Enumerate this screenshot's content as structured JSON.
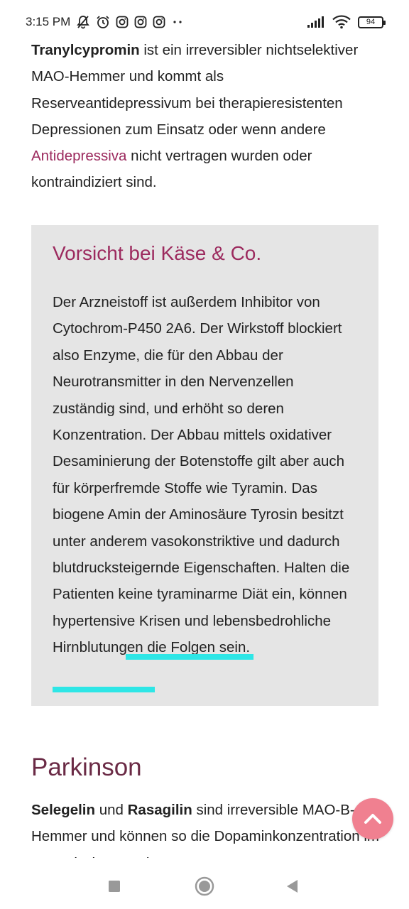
{
  "status_bar": {
    "time": "3:15 PM",
    "battery": "94",
    "icons": [
      "silent-bell-icon",
      "alarm-icon",
      "instagram-icon",
      "instagram-icon",
      "instagram-icon",
      "more-dots-icon",
      "signal-icon",
      "wifi-icon",
      "battery-icon"
    ]
  },
  "article": {
    "intro": {
      "term": "Tranylcypromin",
      "text_1": " ist ein irreversibler nichtselektiver MAO-Hemmer und kommt als Reserveantidepressivum bei therapieresistenten Depressionen zum Einsatz oder wenn andere ",
      "link": "Antidepressiva",
      "text_2": " nicht vertragen wurden oder kontraindiziert sind."
    },
    "callout": {
      "title": "Vorsicht bei Käse & Co.",
      "body": "Der Arzneistoff ist außerdem Inhibitor von Cytochrom-P450 2A6. Der Wirkstoff blockiert also Enzyme, die für den Abbau der Neurotransmitter in den Nervenzellen zuständig sind, und erhöht so deren Konzentration. Der Abbau mittels oxidativer Desaminierung der Botenstoffe gilt aber auch für körperfremde Stoffe wie Tyramin. Das biogene Amin der Aminosäure Tyrosin besitzt unter anderem vasokonstriktive und dadurch blutdrucksteigernde Eigenschaften. Halten die Patienten keine tyraminarme Diät ein, können hypertensive Krisen und ",
      "highlight": "lebensbedrohliche Hirnblutungen",
      "body_end": " die Folgen sein."
    },
    "section": {
      "title": "Parkinson",
      "term_1": "Selegelin",
      "and": " und ",
      "term_2": "Rasagilin",
      "text": " sind irreversible MAO-B-Hemmer und können so die Dopaminkonzentration im synaptischen Spalt"
    }
  },
  "colors": {
    "accent": "#9c2a5e",
    "section_title": "#6a2a45",
    "callout_bg": "#e5e5e5",
    "highlight": "#2ee6e6",
    "scroll_button": "#f08090"
  },
  "nav": {
    "icons": [
      "recents-square-icon",
      "home-circle-icon",
      "back-triangle-icon"
    ]
  }
}
